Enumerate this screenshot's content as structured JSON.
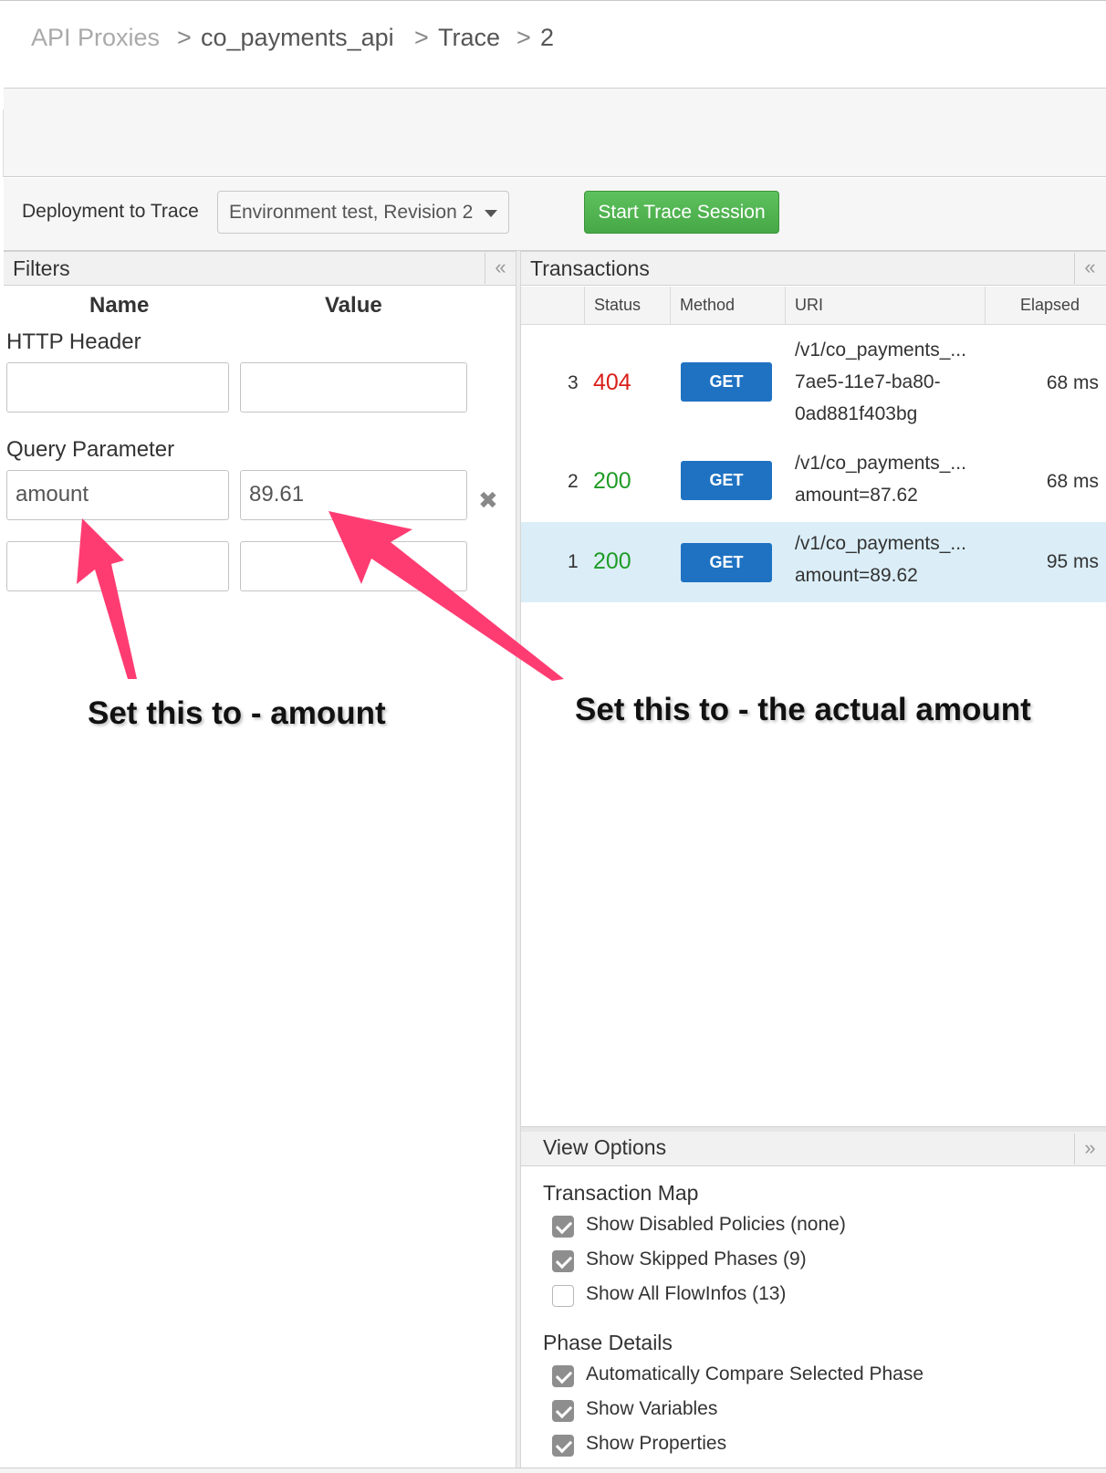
{
  "breadcrumb": {
    "root": "API Proxies",
    "sep": ">",
    "proxy": "co_payments_api",
    "section": "Trace",
    "revision": "2"
  },
  "toolbar": {
    "deploy_label": "Deployment to Trace",
    "deploy_value": "Environment test, Revision 2",
    "start_label": "Start Trace Session"
  },
  "filters": {
    "title": "Filters",
    "collapse": "«",
    "name_header": "Name",
    "value_header": "Value",
    "http_header_label": "HTTP Header",
    "query_param_label": "Query Parameter",
    "query_name": "amount",
    "query_value": "89.61",
    "remove_glyph": "✖"
  },
  "transactions": {
    "title": "Transactions",
    "collapse": "«",
    "columns": [
      "Status",
      "Method",
      "URI",
      "Elapsed"
    ],
    "rows": [
      {
        "num": "3",
        "status": "404",
        "method": "GET",
        "uri": [
          "/v1/co_payments_...",
          "7ae5-11e7-ba80-",
          "0ad881f403bg"
        ],
        "elapsed": "68 ms"
      },
      {
        "num": "2",
        "status": "200",
        "method": "GET",
        "uri": [
          "/v1/co_payments_...",
          "amount=87.62"
        ],
        "elapsed": "68 ms"
      },
      {
        "num": "1",
        "status": "200",
        "method": "GET",
        "uri": [
          "/v1/co_payments_...",
          "amount=89.62"
        ],
        "elapsed": "95 ms"
      }
    ]
  },
  "view_options": {
    "title": "View Options",
    "collapse": "»",
    "transaction_map": "Transaction Map",
    "tm_options": [
      {
        "label": "Show Disabled Policies (none)",
        "checked": true
      },
      {
        "label": "Show Skipped Phases (9)",
        "checked": true
      },
      {
        "label": "Show All FlowInfos (13)",
        "checked": false
      }
    ],
    "phase_details": "Phase Details",
    "pd_options": [
      {
        "label": "Automatically Compare Selected Phase",
        "checked": true
      },
      {
        "label": "Show Variables",
        "checked": true
      },
      {
        "label": "Show Properties",
        "checked": true
      }
    ]
  },
  "annotations": {
    "left": "Set this to - amount",
    "right": "Set this to - the actual amount",
    "arrow_color": "#ff3c72"
  },
  "colors": {
    "start_button": "#4cae4c",
    "get_button": "#1f72c2",
    "status_error": "#d9201b",
    "status_ok": "#1f9c26",
    "selected_row": "#dbeef8"
  }
}
